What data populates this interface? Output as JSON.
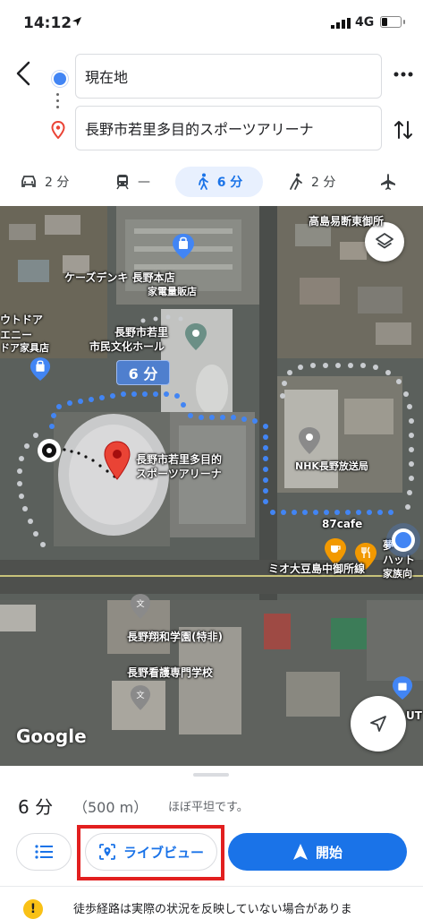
{
  "status_bar": {
    "time": "14:12",
    "network": "4G"
  },
  "directions": {
    "origin": "現在地",
    "destination": "長野市若里多目的スポーツアリーナ"
  },
  "modes": [
    {
      "name": "car-icon",
      "label": "2 分"
    },
    {
      "name": "transit-icon",
      "label": "—"
    },
    {
      "name": "walk-icon",
      "label": "6 分",
      "active": true
    },
    {
      "name": "rideshare-icon",
      "label": "2 分"
    },
    {
      "name": "flight-icon",
      "label": ""
    }
  ],
  "map": {
    "route_time": "6 分",
    "places": {
      "takashima": "高島易断東御所",
      "ksdenki_1": "ケーズデンキ 長野本店",
      "ksdenki_2": "家電量販店",
      "outdoor_1": "ウトドア",
      "outdoor_2": "エニー",
      "outdoor_3": "ドア家具店",
      "hall_1": "長野市若里",
      "hall_2": "市民文化ホール",
      "arena_1": "長野市若里多目的",
      "arena_2": "スポーツアリーナ",
      "nhk": "NHK長野放送局",
      "cafe": "87cafe",
      "yume_1": "夢",
      "yume_2": "ハット",
      "yume_3": "家族向",
      "road": "ミオ大豆島中御所線",
      "school1": "長野翔和学園(特非)",
      "school2": "長野看護専門学校",
      "ut": "UT"
    },
    "attribution": "Google"
  },
  "summary": {
    "duration": "6 分",
    "distance": "（500 m）",
    "terrain": "ほぼ平坦です。"
  },
  "buttons": {
    "live_view": "ライブビュー",
    "start": "開始"
  },
  "warning": {
    "icon": "!",
    "text": "徒歩経路は実際の状況を反映していない場合がありま"
  },
  "colors": {
    "accent": "#1a73e8",
    "highlight": "#e21f1f",
    "pin_red": "#ea4335",
    "route": "#4285f4"
  }
}
